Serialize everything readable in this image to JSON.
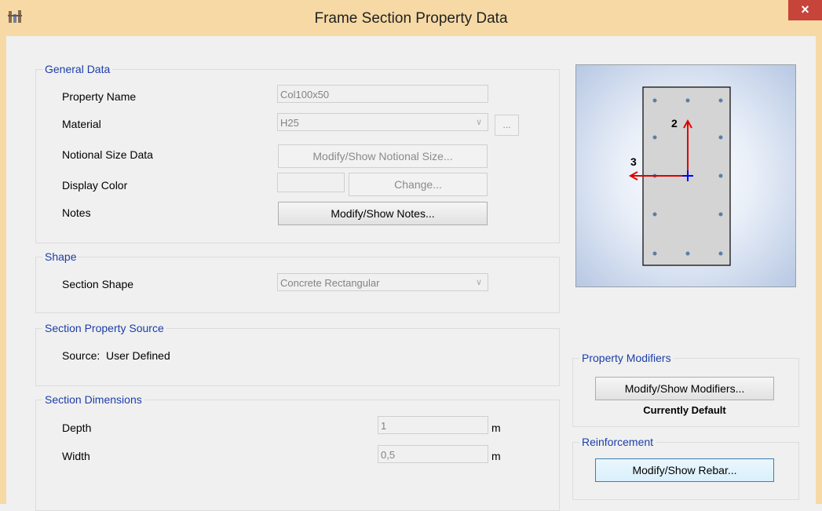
{
  "window": {
    "title": "Frame Section Property Data",
    "close_glyph": "×",
    "icon": "app-icon"
  },
  "general": {
    "legend": "General Data",
    "property_name_label": "Property Name",
    "property_name_value": "Col100x50",
    "material_label": "Material",
    "material_value": "H25",
    "material_more": "...",
    "notional_label": "Notional Size Data",
    "notional_button": "Modify/Show Notional Size...",
    "display_color_label": "Display Color",
    "change_button": "Change...",
    "notes_label": "Notes",
    "notes_button": "Modify/Show Notes..."
  },
  "shape": {
    "legend": "Shape",
    "section_shape_label": "Section Shape",
    "section_shape_value": "Concrete Rectangular"
  },
  "source": {
    "legend": "Section Property Source",
    "text": "Source:  User Defined"
  },
  "dimensions": {
    "legend": "Section Dimensions",
    "depth_label": "Depth",
    "depth_value": "1",
    "depth_unit": "m",
    "width_label": "Width",
    "width_value": "0,5",
    "width_unit": "m"
  },
  "preview": {
    "axis2_label": "2",
    "axis3_label": "3"
  },
  "modifiers": {
    "legend": "Property Modifiers",
    "button": "Modify/Show Modifiers...",
    "status": "Currently Default"
  },
  "reinforcement": {
    "legend": "Reinforcement",
    "button": "Modify/Show Rebar..."
  },
  "colors": {
    "title_bar": "#f6d9a5",
    "legend_text": "#1c3ea8",
    "close_button": "#c7443a",
    "axis_arrow": "#e00000",
    "origin_cross": "#0000ff"
  }
}
